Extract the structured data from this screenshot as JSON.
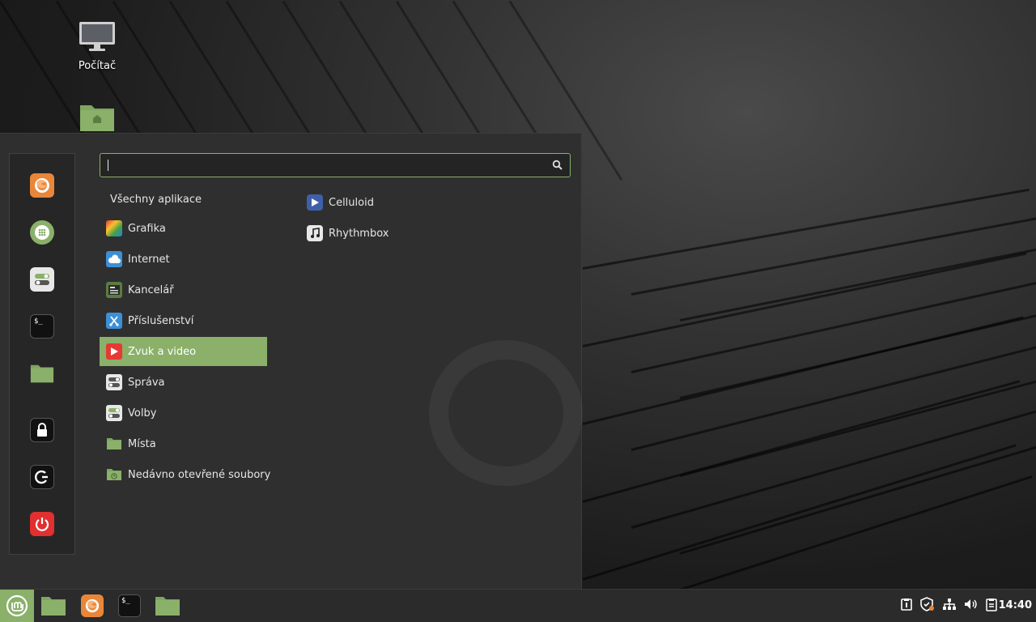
{
  "desktop": {
    "icons": [
      {
        "label": "Počítač",
        "icon": "computer-icon"
      },
      {
        "label": "",
        "icon": "home-folder-icon"
      }
    ]
  },
  "menu": {
    "search": {
      "value": "",
      "placeholder": ""
    },
    "favorites": [
      {
        "name": "firefox",
        "icon": "firefox-icon"
      },
      {
        "name": "software-manager",
        "icon": "software-manager-icon"
      },
      {
        "name": "system-settings",
        "icon": "settings-icon"
      },
      {
        "name": "terminal",
        "icon": "terminal-icon"
      },
      {
        "name": "files",
        "icon": "folder-icon"
      },
      {
        "name": "lock-screen",
        "icon": "lock-icon"
      },
      {
        "name": "logout",
        "icon": "logout-icon"
      },
      {
        "name": "shutdown",
        "icon": "power-icon"
      }
    ],
    "categories_header": "Všechny aplikace",
    "categories": [
      {
        "label": "Grafika",
        "icon": "graphics-icon"
      },
      {
        "label": "Internet",
        "icon": "internet-icon"
      },
      {
        "label": "Kancelář",
        "icon": "office-icon"
      },
      {
        "label": "Příslušenství",
        "icon": "accessories-icon"
      },
      {
        "label": "Zvuk a video",
        "icon": "multimedia-icon",
        "active": true
      },
      {
        "label": "Správa",
        "icon": "administration-icon"
      },
      {
        "label": "Volby",
        "icon": "preferences-icon"
      },
      {
        "label": "Místa",
        "icon": "places-folder-icon"
      },
      {
        "label": "Nedávno otevřené soubory",
        "icon": "recent-files-icon"
      }
    ],
    "apps": [
      {
        "label": "Celluloid",
        "icon": "celluloid-icon"
      },
      {
        "label": "Rhythmbox",
        "icon": "rhythmbox-icon"
      }
    ]
  },
  "panel": {
    "launchers": [
      "mint-menu-icon",
      "show-desktop-icon",
      "firefox-icon",
      "terminal-icon",
      "files-icon"
    ],
    "tray": [
      "clipboard-icon",
      "update-shield-icon",
      "network-icon",
      "volume-icon",
      "notes-icon"
    ],
    "clock": "14:40"
  },
  "colors": {
    "accent": "#8ab06a",
    "menu_bg": "#2f2f2f",
    "panel_bg": "#2b2b2b"
  }
}
